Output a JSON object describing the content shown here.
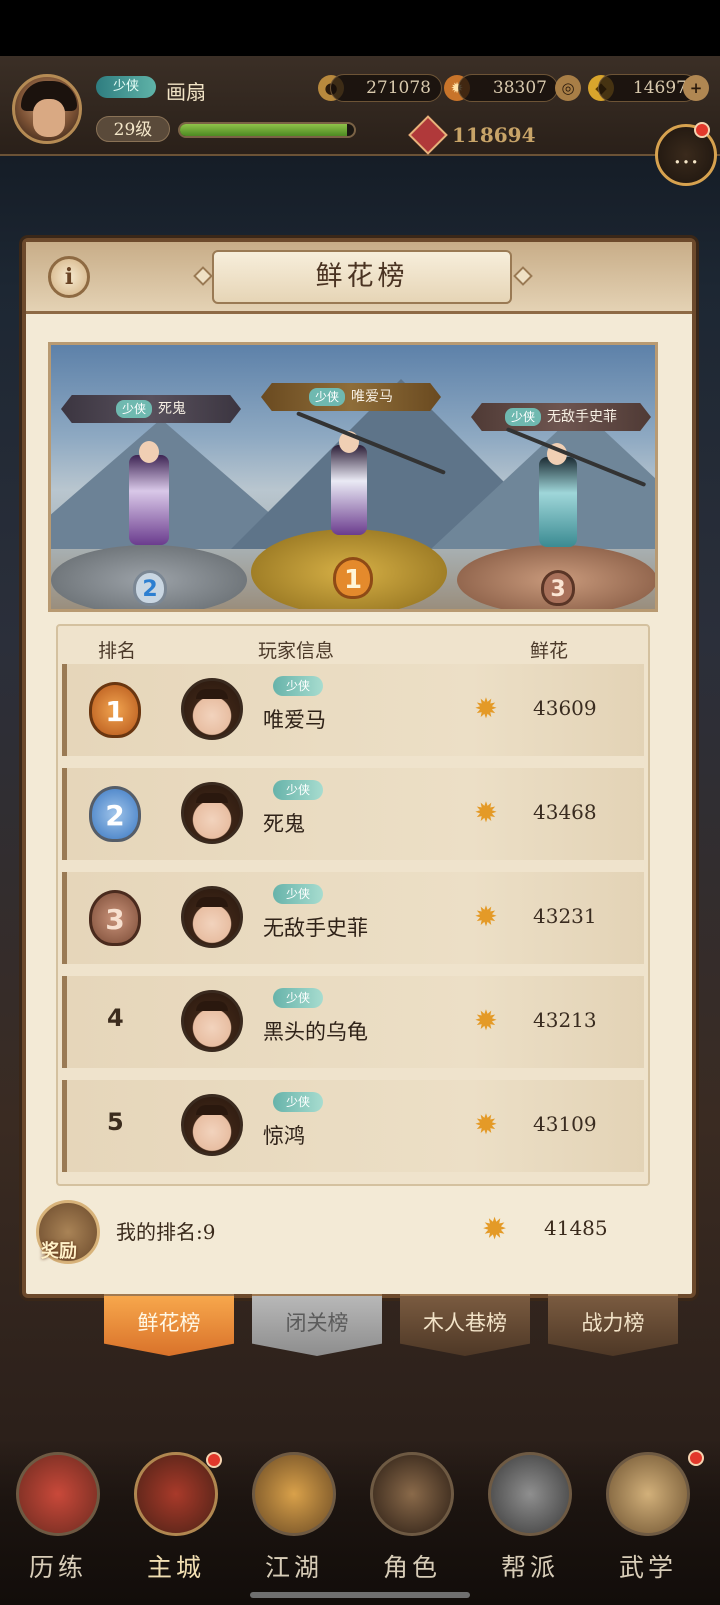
{
  "hud": {
    "title_tag": "少侠",
    "player_name": "画扇",
    "level": "29级",
    "exp_fraction": 0.96,
    "coins": "271078",
    "flowers": "38307",
    "gold": "14697",
    "power": "118694"
  },
  "panel": {
    "title": "鲜花榜",
    "info_icon": "i"
  },
  "podium": {
    "first": {
      "tag": "少侠",
      "name": "唯爱马",
      "rank": "1"
    },
    "second": {
      "tag": "少侠",
      "name": "死鬼",
      "rank": "2"
    },
    "third": {
      "tag": "少侠",
      "name": "无敌手史菲",
      "rank": "3"
    }
  },
  "board": {
    "headers": {
      "rank": "排名",
      "player": "玩家信息",
      "flowers": "鲜花"
    },
    "rows": [
      {
        "rank": "1",
        "tag": "少侠",
        "name": "唯爱马",
        "value": "43609"
      },
      {
        "rank": "2",
        "tag": "少侠",
        "name": "死鬼",
        "value": "43468"
      },
      {
        "rank": "3",
        "tag": "少侠",
        "name": "无敌手史菲",
        "value": "43231"
      },
      {
        "rank": "4",
        "tag": "少侠",
        "name": "黑头的乌龟",
        "value": "43213"
      },
      {
        "rank": "5",
        "tag": "少侠",
        "name": "惊鸿",
        "value": "43109"
      }
    ]
  },
  "my_rank": {
    "reward_label": "奖励",
    "text": "我的排名:9",
    "value": "41485"
  },
  "tabs": [
    {
      "label": "鲜花榜",
      "state": "active"
    },
    {
      "label": "闭关榜",
      "state": "disabled"
    },
    {
      "label": "木人巷榜",
      "state": "normal"
    },
    {
      "label": "战力榜",
      "state": "normal"
    }
  ],
  "nav": [
    {
      "label": "历练",
      "icon": "scroll-pouch-icon"
    },
    {
      "label": "主城",
      "icon": "city-gate-icon"
    },
    {
      "label": "江湖",
      "icon": "sword-gourd-icon"
    },
    {
      "label": "角色",
      "icon": "swordsman-icon"
    },
    {
      "label": "帮派",
      "icon": "clan-seal-icon"
    },
    {
      "label": "武学",
      "icon": "scrolls-icon"
    }
  ],
  "colors": {
    "accent": "#d9722a",
    "panel": "#f3ead6",
    "tag": "#67b3aa",
    "flower": "#e49a27"
  }
}
